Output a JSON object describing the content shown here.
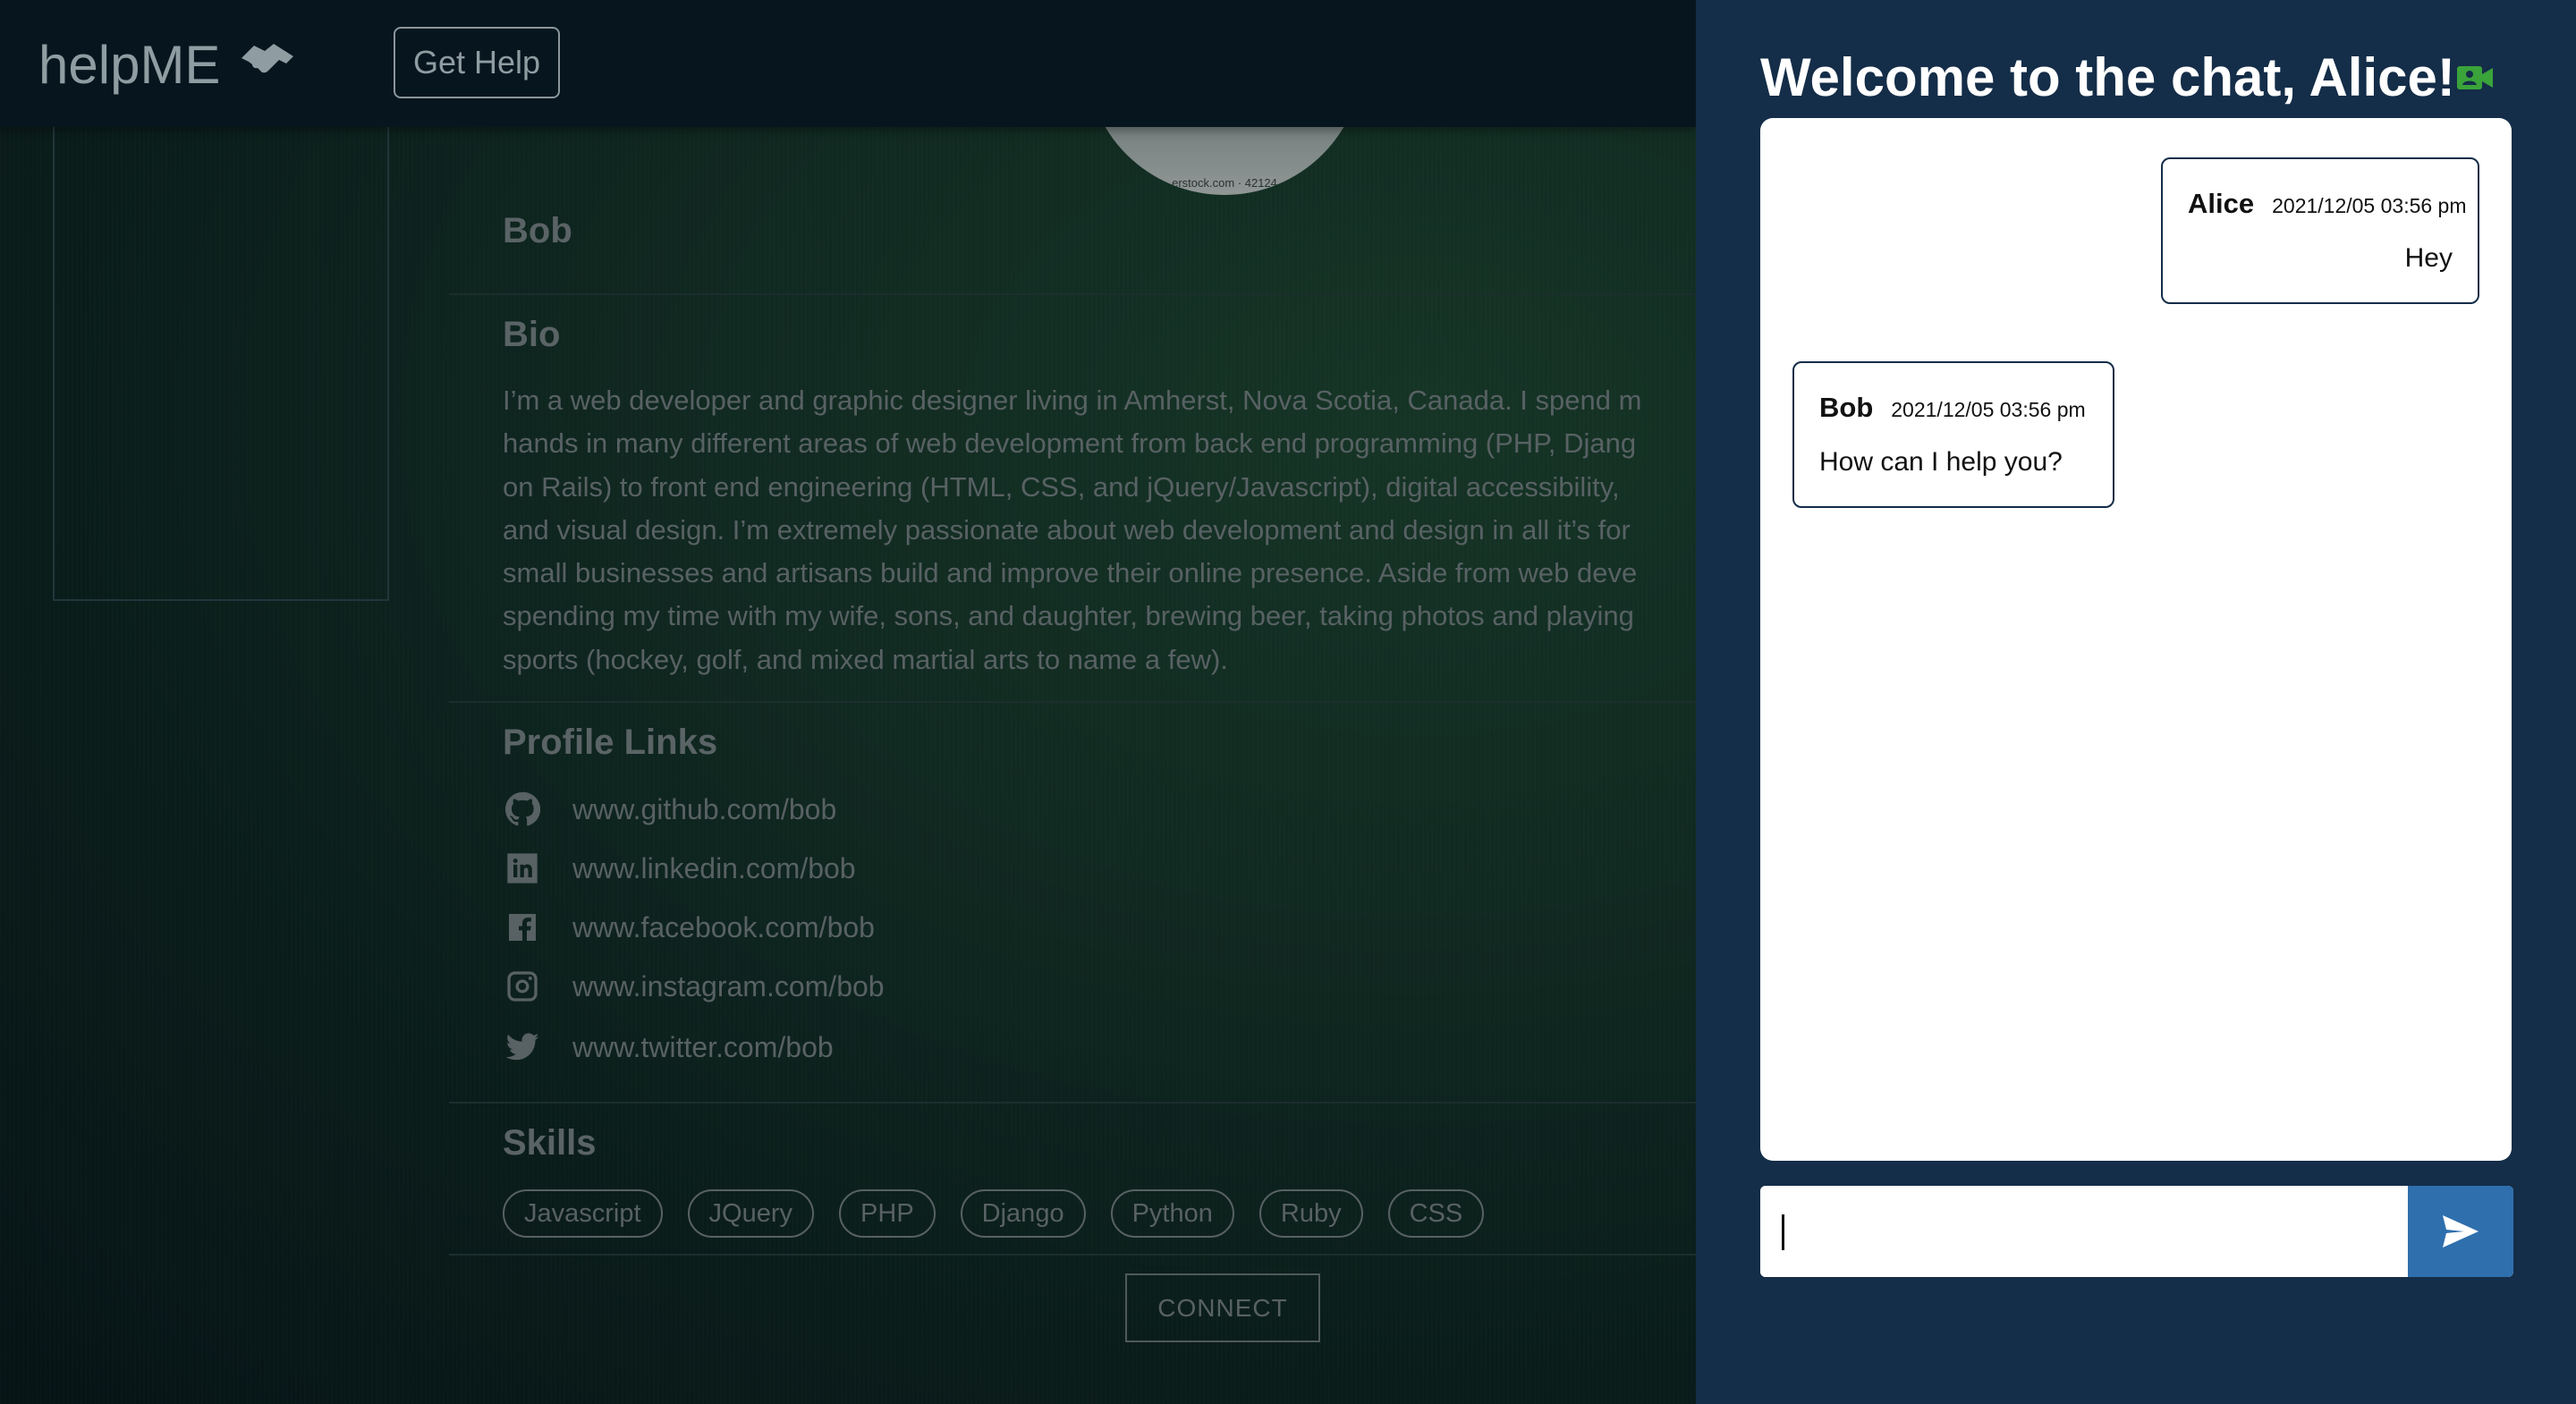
{
  "navbar": {
    "brand": "helpME",
    "brand_icon": "handshake-icon",
    "get_help_label": "Get Help"
  },
  "profile": {
    "avatar_caption": "erstock.com · 42124",
    "name": "Bob",
    "bio_heading": "Bio",
    "bio_lines": [
      "I’m a web developer and graphic designer living in Amherst, Nova Scotia, Canada. I spend m",
      "hands in many different areas of web development from back end programming (PHP, Djang",
      "on Rails) to front end engineering (HTML, CSS, and jQuery/Javascript), digital accessibility,",
      "and visual design. I’m extremely passionate about web development and design in all it’s for",
      "small businesses and artisans build and improve their online presence. Aside from web deve",
      "spending my time with my wife, sons, and daughter, brewing beer, taking photos and playing",
      "sports (hockey, golf, and mixed martial arts to name a few)."
    ],
    "links_heading": "Profile Links",
    "links": [
      {
        "icon": "github-icon",
        "text": "www.github.com/bob"
      },
      {
        "icon": "linkedin-icon",
        "text": "www.linkedin.com/bob"
      },
      {
        "icon": "facebook-icon",
        "text": "www.facebook.com/bob"
      },
      {
        "icon": "instagram-icon",
        "text": "www.instagram.com/bob"
      },
      {
        "icon": "twitter-icon",
        "text": "www.twitter.com/bob"
      }
    ],
    "skills_heading": "Skills",
    "skills": [
      "Javascript",
      "JQuery",
      "PHP",
      "Django",
      "Python",
      "Ruby",
      "CSS"
    ],
    "connect_label": "CONNECT"
  },
  "chat": {
    "title": "Welcome to the chat, Alice!",
    "video_icon": "video-camera-icon",
    "video_icon_color": "#3aa33a",
    "messages": [
      {
        "sender": "Alice",
        "time": "2021/12/05 03:56 pm",
        "text": "Hey"
      },
      {
        "sender": "Bob",
        "time": "2021/12/05 03:56 pm",
        "text": "How can I help you?"
      }
    ],
    "input_value": "",
    "send_icon": "send-icon",
    "send_color": "#2f6fad",
    "panel_color": "#142d48"
  }
}
